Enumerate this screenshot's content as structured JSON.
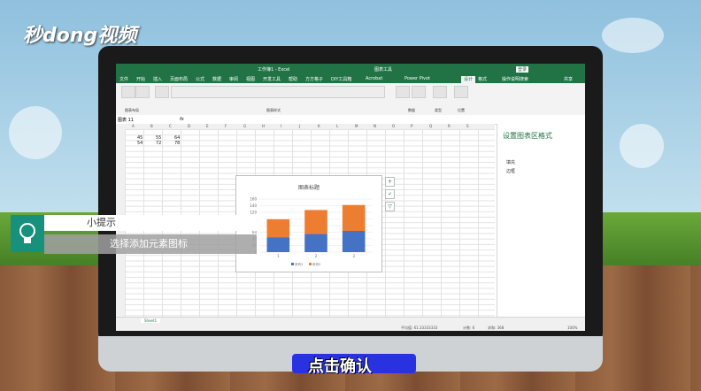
{
  "brand": {
    "watermark": "秒dong视频"
  },
  "excel": {
    "window_title": "工作簿1 - Excel",
    "context_tab": "图表工具",
    "login_label": "登录",
    "tabs": [
      "文件",
      "开始",
      "插入",
      "页面布局",
      "公式",
      "数据",
      "审阅",
      "视图",
      "开发工具",
      "帮助",
      "方方格子",
      "DIY工具箱",
      "Acrobat",
      "Power Pivot",
      "设计",
      "格式"
    ],
    "active_tab": "设计",
    "tell_me": "操作说明搜索",
    "share": "共享",
    "ribbon_groups": [
      "图表布局",
      "图表样式",
      "数据",
      "类型",
      "位置"
    ],
    "ribbon_buttons": [
      "添加图表元素",
      "快速布局",
      "更改颜色",
      "切换行/列",
      "选择数据",
      "更改图表类型",
      "移动图表"
    ],
    "name_box": "图表 11",
    "fx_label": "fx",
    "columns": [
      "A",
      "B",
      "C",
      "D",
      "E",
      "F",
      "G",
      "H",
      "I",
      "J",
      "K",
      "L",
      "M",
      "N",
      "O",
      "P",
      "Q",
      "R",
      "S"
    ],
    "rows": [
      "1",
      "2",
      "3",
      "4",
      "5",
      "6",
      "7",
      "8",
      "9",
      "10",
      "11",
      "12",
      "13",
      "14",
      "15",
      "16",
      "17",
      "18",
      "19",
      "20",
      "21",
      "22",
      "23",
      "24",
      "25",
      "26",
      "27",
      "28",
      "29",
      "30",
      "31",
      "32",
      "33",
      "34"
    ],
    "cells": {
      "r1": [
        "45",
        "55",
        "64"
      ],
      "r2": [
        "54",
        "72",
        "78"
      ]
    },
    "sheet_tab": "Sheet1",
    "status": {
      "average": "平均值: 61.33333333",
      "count": "计数: 6",
      "sum": "求和: 368",
      "zoom": "100%"
    },
    "format_pane": {
      "title": "设置图表区格式",
      "options": [
        "填充",
        "边框"
      ]
    }
  },
  "chart_data": {
    "type": "bar",
    "stacked": true,
    "title": "图表标题",
    "categories": [
      "1",
      "2",
      "3"
    ],
    "series": [
      {
        "name": "系列1",
        "values": [
          45,
          55,
          64
        ],
        "color": "#4472c4"
      },
      {
        "name": "系列2",
        "values": [
          54,
          72,
          78
        ],
        "color": "#ed7d31"
      }
    ],
    "ylim": [
      0,
      160
    ],
    "yticks": [
      "0",
      "20",
      "40",
      "60",
      "80",
      "100",
      "120",
      "140",
      "160"
    ],
    "legend": "bottom",
    "grid": true
  },
  "overlay": {
    "tip_title": "小提示",
    "tip_body": "选择添加元素图标",
    "subtitle": "点击确认"
  },
  "colors": {
    "excel_green": "#217346",
    "tip_teal": "#17907c"
  }
}
